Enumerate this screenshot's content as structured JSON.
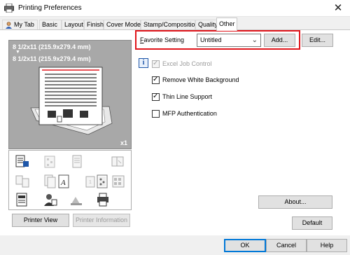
{
  "window": {
    "title": "Printing Preferences",
    "close_glyph": "✕"
  },
  "tabs": [
    {
      "label": "My Tab",
      "active": false
    },
    {
      "label": "Basic",
      "active": false
    },
    {
      "label": "Layout",
      "active": false
    },
    {
      "label": "Finish",
      "active": false
    },
    {
      "label": "Cover Mode",
      "active": false
    },
    {
      "label": "Stamp/Composition",
      "active": false
    },
    {
      "label": "Quality",
      "active": false
    },
    {
      "label": "Other",
      "active": true
    }
  ],
  "preview": {
    "original_size": "8 1/2x11 (215.9x279.4 mm)",
    "arrow": "▼",
    "output_size": "8 1/2x11 (215.9x279.4 mm)",
    "copies": "x1"
  },
  "favorite": {
    "label_first": "F",
    "label_rest": "avorite Setting",
    "value": "Untitled",
    "add_label": "Add...",
    "edit_label": "Edit..."
  },
  "options": [
    {
      "label": "Excel Job Control",
      "checked": true,
      "disabled": true
    },
    {
      "label": "Remove White Background",
      "checked": true,
      "disabled": false
    },
    {
      "label": "Thin Line Support",
      "checked": true,
      "disabled": false
    },
    {
      "label": "MFP Authentication",
      "checked": false,
      "disabled": false
    }
  ],
  "buttons": {
    "printer_view": "Printer View",
    "printer_information": "Printer Information",
    "about": "About...",
    "default": "Default",
    "ok": "OK",
    "cancel": "Cancel",
    "help": "Help"
  },
  "colors": {
    "highlight": "#e0151b",
    "accent": "#0078d7",
    "preview_bg": "#a8a8a8"
  }
}
